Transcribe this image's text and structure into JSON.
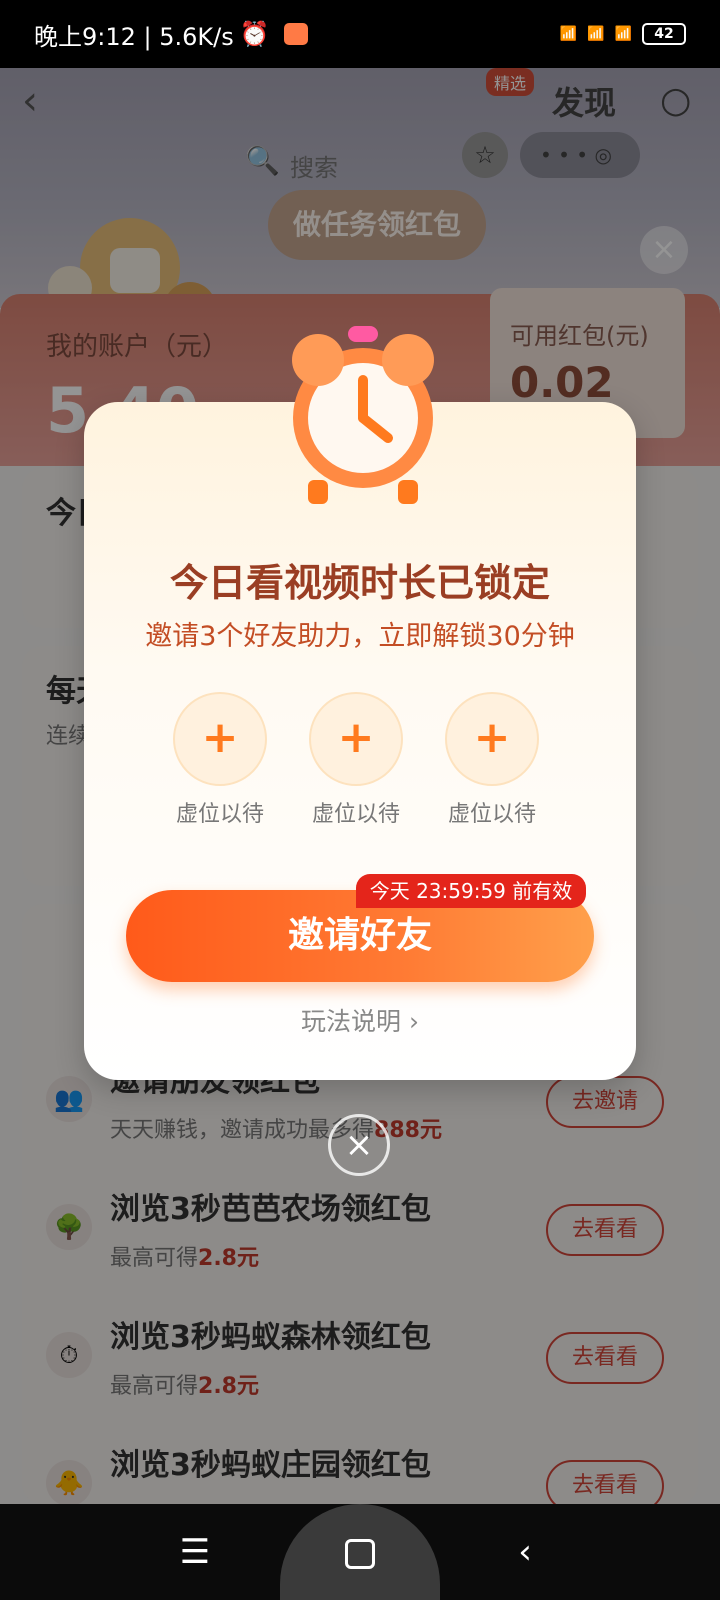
{
  "status_bar": {
    "time_speed": "晚上9:12 | 5.6K/s",
    "battery": "42",
    "signals": [
      "HD",
      "HD"
    ]
  },
  "top_nav": {
    "discover": "发现",
    "badge_jingxuan": "精选",
    "search_placeholder": "搜索",
    "task_bubble": "做任务领红包"
  },
  "account": {
    "label": "我的账户（元）",
    "amount": "5.40",
    "hongbao_label": "可用红包(元)",
    "hongbao_value": "0.02"
  },
  "sections": {
    "sec1_title": "今日",
    "sec2_title": "每天",
    "sec2_sub": "连续"
  },
  "tasks": [
    {
      "title": "邀请朋友领红包",
      "desc_prefix": "天天赚钱，邀请成功最多得",
      "desc_highlight": "888元",
      "button": "去邀请",
      "icon": "people-icon"
    },
    {
      "title": "浏览3秒芭芭农场领红包",
      "desc_prefix": "最高可得",
      "desc_highlight": "2.8元",
      "button": "去看看",
      "icon": "farm-icon"
    },
    {
      "title": "浏览3秒蚂蚁森林领红包",
      "desc_prefix": "最高可得",
      "desc_highlight": "2.8元",
      "button": "去看看",
      "icon": "forest-icon"
    },
    {
      "title": "浏览3秒蚂蚁庄园领红包",
      "desc_prefix": "",
      "desc_highlight": "",
      "button": "去看看",
      "icon": "chick-icon"
    }
  ],
  "modal": {
    "title": "今日看视频时长已锁定",
    "subtitle": "邀请3个好友助力，立即解锁30分钟",
    "slots": [
      "虚位以待",
      "虚位以待",
      "虚位以待"
    ],
    "slot_symbol": "+",
    "cta": "邀请好友",
    "cta_badge": "今天 23:59:59 前有效",
    "rules": "玩法说明"
  },
  "colors": {
    "accent": "#ff6a2a",
    "title": "#9a3e23",
    "badge": "#e4251b"
  }
}
